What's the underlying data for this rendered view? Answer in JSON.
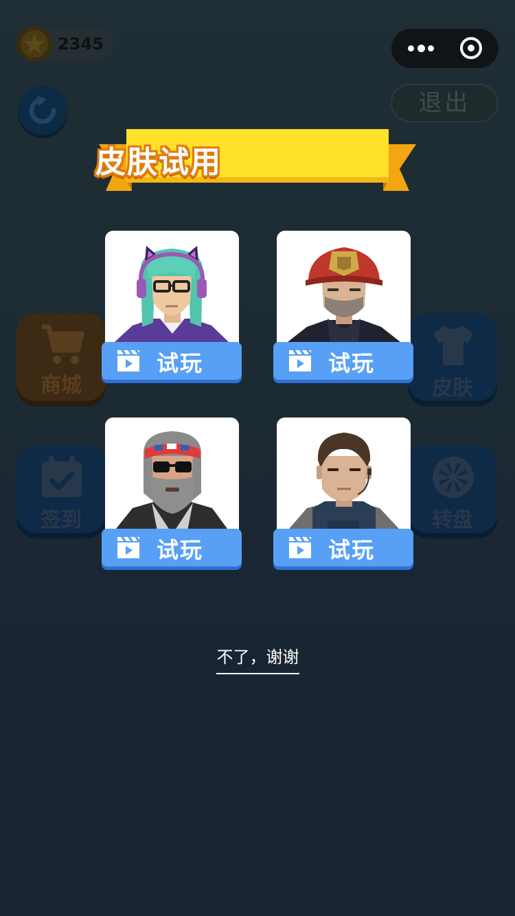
{
  "header": {
    "coins": "2345",
    "exit_label": "退出"
  },
  "banner": {
    "title": "皮肤试用"
  },
  "side_menu": {
    "shop_label": "商城",
    "skin_label": "皮肤",
    "checkin_label": "签到",
    "wheel_label": "转盘"
  },
  "skins": [
    {
      "character": "gamer-girl",
      "button_label": "试玩"
    },
    {
      "character": "firefighter",
      "button_label": "试玩"
    },
    {
      "character": "biker",
      "button_label": "试玩"
    },
    {
      "character": "agent",
      "button_label": "试玩"
    }
  ],
  "footer": {
    "decline_label": "不了，谢谢"
  },
  "colors": {
    "background": "#1b2533",
    "banner_yellow": "#ffe12a",
    "banner_outline": "#e07b10",
    "try_button": "#57a0f5",
    "card": "#ffffff"
  }
}
